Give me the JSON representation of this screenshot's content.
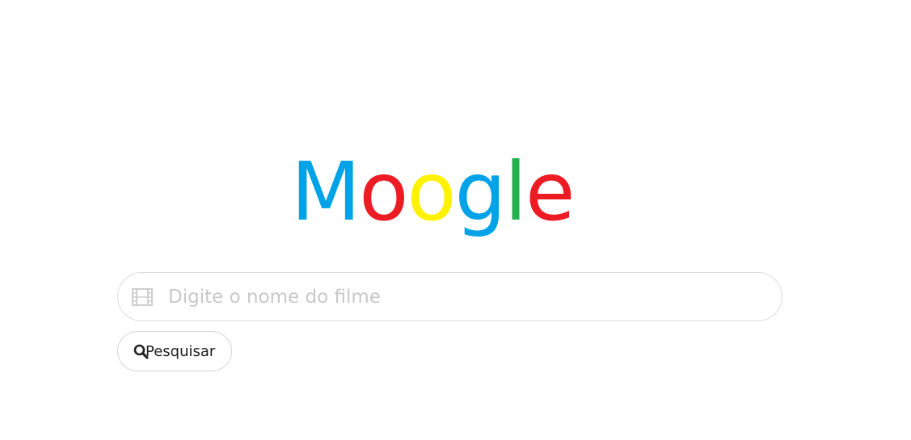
{
  "logo": {
    "letters": [
      {
        "char": "M",
        "color": "#00a2e8"
      },
      {
        "char": "o",
        "color": "#ed1c24"
      },
      {
        "char": "o",
        "color": "#fff200"
      },
      {
        "char": "g",
        "color": "#00a2e8"
      },
      {
        "char": "l",
        "color": "#22b14c"
      },
      {
        "char": "e",
        "color": "#ed1c24"
      }
    ]
  },
  "search": {
    "icon": "film-icon",
    "placeholder": "Digite o nome do filme",
    "value": ""
  },
  "search_button": {
    "icon": "search-icon",
    "label": "Pesquisar"
  }
}
